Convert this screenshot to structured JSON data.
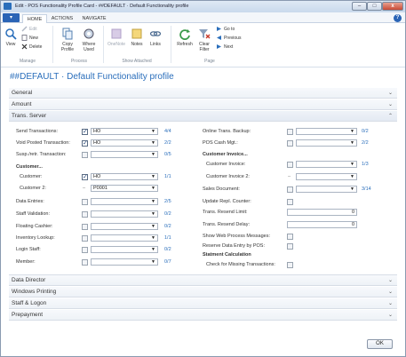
{
  "window": {
    "title": "Edit - POS Functionality Profile Card - ##DEFAULT · Default Functionality profile",
    "minimize": "–",
    "maximize": "□",
    "close": "x"
  },
  "ribbon": {
    "app_menu": "▾",
    "tabs": [
      "HOME",
      "ACTIONS",
      "NAVIGATE"
    ],
    "help": "?",
    "manage": {
      "label": "Manage",
      "view": "View",
      "edit": "Edit",
      "new": "New",
      "delete": "Delete"
    },
    "process": {
      "label": "Process",
      "copy_profile": "Copy Profile",
      "where_used": "Where Used"
    },
    "show_attached": {
      "label": "Show Attached",
      "onenote": "OneNote",
      "notes": "Notes",
      "links": "Links"
    },
    "page": {
      "label": "Page",
      "refresh": "Refresh",
      "clear_filter": "Clear Filter",
      "go_to": "Go to",
      "previous": "Previous",
      "next": "Next"
    }
  },
  "page_title": "##DEFAULT · Default Functionality profile",
  "fasttabs": {
    "general": "General",
    "amount": "Amount",
    "trans_server": "Trans. Server",
    "data_director": "Data Director",
    "windows_printing": "Windows Printing",
    "staff_logon": "Staff & Logon",
    "prepayment": "Prepayment"
  },
  "trans_server": {
    "left": {
      "send_transactions": {
        "label": "Send Transactions:",
        "checked": true,
        "value": "HO",
        "count": "4/4"
      },
      "void_posted": {
        "label": "Void Posted Transaction:",
        "checked": true,
        "value": "HO",
        "count": "2/2"
      },
      "susp_retr": {
        "label": "Susp./retr. Transaction:",
        "checked": false,
        "value": "",
        "count": "0/5"
      },
      "customer_heading": "Customer...",
      "customer": {
        "label": "Customer:",
        "checked": true,
        "value": "HO",
        "count": "1/1"
      },
      "customer2": {
        "label": "Customer 2:",
        "dash": "–",
        "value": "P0001"
      },
      "data_entries": {
        "label": "Data Entries:",
        "checked": false,
        "value": "",
        "count": "2/5"
      },
      "staff_validation": {
        "label": "Staff Validation:",
        "checked": false,
        "value": "",
        "count": "0/2"
      },
      "floating_cashier": {
        "label": "Floating Cashier:",
        "checked": false,
        "value": "",
        "count": "0/2"
      },
      "inventory_lookup": {
        "label": "Inventory Lookup:",
        "checked": false,
        "value": "",
        "count": "1/1"
      },
      "login_staff": {
        "label": "Login Staff:",
        "checked": false,
        "value": "",
        "count": "0/2"
      },
      "member": {
        "label": "Member:",
        "checked": false,
        "value": "",
        "count": "0/7"
      }
    },
    "right": {
      "online_backup": {
        "label": "Online Trans. Backup:",
        "checked": false,
        "value": "",
        "count": "0/2"
      },
      "pos_cash_mgt": {
        "label": "POS Cash Mgt.:",
        "checked": false,
        "value": "",
        "count": "2/2"
      },
      "customer_invoice_heading": "Customer Invoice...",
      "customer_invoice": {
        "label": "Customer Invoice:",
        "checked": false,
        "value": "",
        "count": "1/3"
      },
      "customer_invoice2": {
        "label": "Customer Invoice 2:",
        "dash": "–",
        "value": ""
      },
      "sales_document": {
        "label": "Sales Document:",
        "checked": false,
        "value": "",
        "count": "3/14"
      },
      "update_repl_counter": {
        "label": "Update Repl. Counter:",
        "checked": false
      },
      "trans_resend_limit": {
        "label": "Trans. Resend Limit:",
        "value": "0"
      },
      "trans_resend_delay": {
        "label": "Trans. Resend Delay:",
        "value": "0"
      },
      "show_web_process": {
        "label": "Show Web Process Messages:",
        "checked": false
      },
      "reserve_data_entry": {
        "label": "Reserve Data Entry by POS:",
        "checked": false
      },
      "statement_heading": "Statment Calculation",
      "check_missing": {
        "label": "Check for Missing Transactions:",
        "checked": false
      }
    }
  },
  "ok_label": "OK",
  "colors": {
    "accent": "#2a6ebb",
    "ribbon_app": "#2a64b6",
    "close": "#c84a35"
  }
}
